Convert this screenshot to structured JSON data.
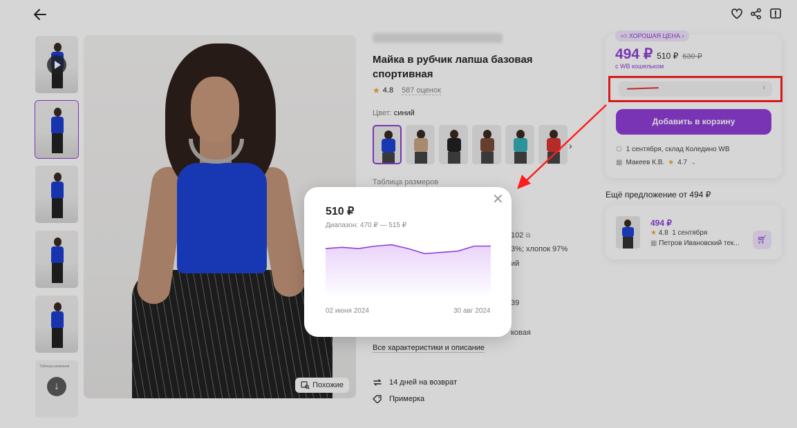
{
  "header": {
    "back_icon": "arrow-left-icon",
    "icons": [
      "heart-icon",
      "share-icon",
      "report-icon"
    ]
  },
  "gallery": {
    "thumbnails": 6,
    "similar_label": "Похожие",
    "size_chart_thumb_text": "Таблица размеров"
  },
  "product": {
    "title": "Майка в рубчик лапша базовая спортивная",
    "rating": "4.8",
    "reviews": "587 оценок",
    "color_label": "Цвет:",
    "color_value": "синий",
    "swatch_colors": [
      "#1d43d6",
      "#c9a584",
      "#222222",
      "#7a4a36",
      "#36b0b8",
      "#d8342f"
    ],
    "size_table_label": "Таблица размеров",
    "spec_fragments": {
      "article": "102",
      "composition": "3%; хлопок 97%",
      "line3": "ий",
      "line4": "39",
      "line5": "ковая"
    },
    "all_specs_link": "Все характеристики и описание",
    "perks": [
      {
        "icon": "return-icon",
        "label": "14 дней на возврат"
      },
      {
        "icon": "tag-icon",
        "label": "Примерка"
      }
    ]
  },
  "buy_panel": {
    "badge": "ХОРОШАЯ ЦЕНА",
    "price": "494 ₽",
    "price_without_wallet": "510 ₽",
    "price_old": "630 ₽",
    "wallet_note": "с WB кошельком",
    "add_to_cart": "Добавить в корзину",
    "delivery": "1 сентября, склад Коледино WB",
    "seller": "Макеев К.В.",
    "seller_rating": "4.7"
  },
  "other_offer": {
    "title": "Ещё предложение от 494 ₽",
    "price": "494 ₽",
    "rating": "4.8",
    "date": "1 сентября",
    "seller": "Петров Ивановский тек..."
  },
  "price_popup": {
    "current": "510 ₽",
    "range": "Диапазон: 470 ₽ — 515 ₽",
    "date_start": "02 июня 2024",
    "date_end": "30 авг 2024",
    "accent": "#8f3fd8"
  },
  "chart_data": {
    "type": "area",
    "title": "",
    "xlabel": "",
    "ylabel": "",
    "x": [
      "02 июня 2024",
      "",
      "",
      "",
      "",
      "",
      "",
      "",
      "",
      "",
      "30 авг 2024"
    ],
    "series": [
      {
        "values": [
          510,
          511,
          510,
          512,
          513,
          510,
          506,
          507,
          508,
          512,
          512
        ]
      }
    ],
    "ylim": [
      470,
      515
    ]
  }
}
